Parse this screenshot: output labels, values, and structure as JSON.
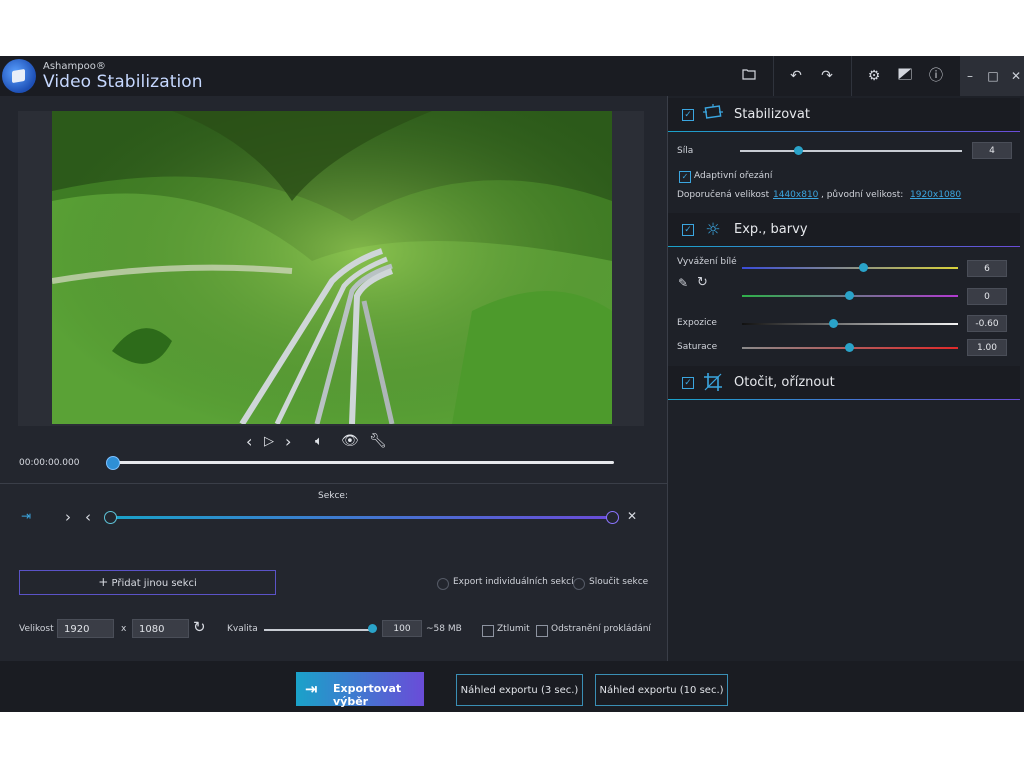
{
  "titlebar": {
    "brand": "Ashampoo®",
    "app_name": "Video Stabilization",
    "icons": [
      "folder-icon",
      "undo-icon",
      "redo-icon",
      "settings-icon",
      "image-icon",
      "info-icon"
    ],
    "window": {
      "minimize": "–",
      "maximize": "□",
      "close": "✕"
    }
  },
  "player": {
    "time": "00:00:00.000",
    "controls": [
      "prev-icon",
      "play-icon",
      "next-icon",
      "volume-icon",
      "eye-icon",
      "wrench-icon"
    ],
    "progress": 0
  },
  "sections": {
    "label": "Sekce:",
    "add_button": "Přidat jinou sekci",
    "export_individual": "Export individuálních sekcí",
    "merge": "Sloučit sekce"
  },
  "output": {
    "size_label": "Velikost",
    "width": "1920",
    "x": "x",
    "height": "1080",
    "quality_label": "Kvalita",
    "quality": "100",
    "size_estimate": "~58 MB",
    "mute_label": "Ztlumit",
    "deinterlace_label": "Odstranění prokládání"
  },
  "stabilize": {
    "title": "Stabilizovat",
    "strength_label": "Síla",
    "strength": "4",
    "adaptive_crop_label": "Adaptivní ořezání",
    "recommended_label": "Doporučená velikost",
    "recommended_value": "1440x810",
    "original_label": ", původní velikost:",
    "original_value": "1920x1080"
  },
  "exposure": {
    "title": "Exp., barvy",
    "white_balance_label": "Vyvážení bílé",
    "wb1": "6",
    "wb2": "0",
    "exposure_label": "Expozice",
    "exposure": "-0.60",
    "saturation_label": "Saturace",
    "saturation": "1.00"
  },
  "rotate": {
    "title": "Otočit, oříznout"
  },
  "export_bar": {
    "export_button": "Exportovat výběr",
    "preview3": "Náhled exportu (3 sec.)",
    "preview10": "Náhled exportu (10 sec.)"
  },
  "colors": {
    "accent": "#1aa2c9",
    "accent2": "#6a4cd8",
    "bg": "#23262e"
  }
}
